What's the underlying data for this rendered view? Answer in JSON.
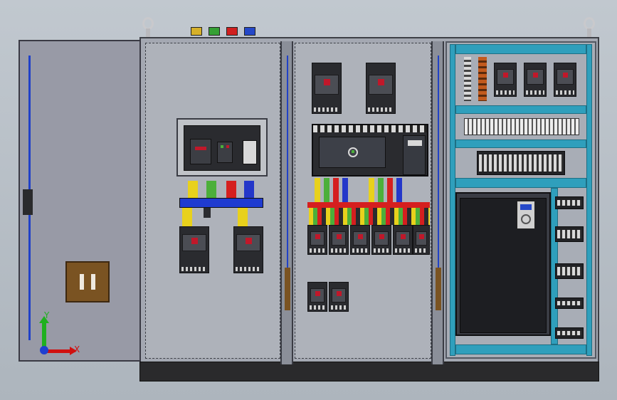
{
  "viewport": {
    "title": "",
    "background_color": "#b4bcc4"
  },
  "axes": {
    "x_label": "X",
    "y_label": "Y",
    "x_color": "#d01010",
    "y_color": "#20b020",
    "z_color": "#1f3fd0"
  },
  "terminal_caps": [
    {
      "color": "#d6b02a",
      "icon": "terminal-yellow"
    },
    {
      "color": "#35a035",
      "icon": "terminal-green"
    },
    {
      "color": "#d02020",
      "icon": "terminal-red"
    },
    {
      "color": "#2548c8",
      "icon": "terminal-blue"
    }
  ],
  "bus_colors": {
    "yellow": "#e8d11c",
    "green": "#4caf3a",
    "red": "#d51f1f",
    "blue": "#2437c9",
    "bar": "#1f3bd0"
  },
  "accent": {
    "handle_red": "#c0182a",
    "teal_rail": "#2f9fbc",
    "door_hardware": "#7a5322"
  }
}
